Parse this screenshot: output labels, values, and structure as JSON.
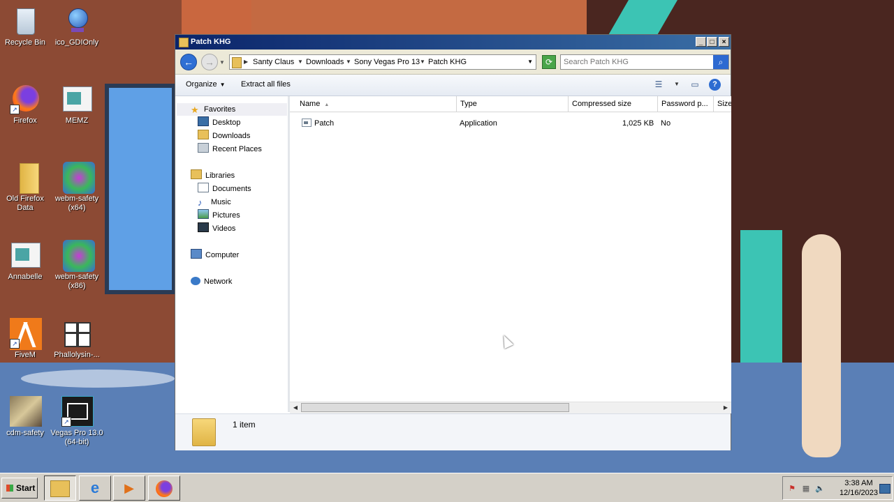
{
  "window": {
    "title": "Patch KHG"
  },
  "address_bar": {
    "crumbs": [
      "Santy Claus",
      "Downloads",
      "Sony Vegas Pro 13",
      "Patch KHG"
    ],
    "search_placeholder": "Search Patch KHG"
  },
  "toolbar": {
    "organize_label": "Organize",
    "extract_label": "Extract all files"
  },
  "nav_pane": {
    "favorites": "Favorites",
    "desktop": "Desktop",
    "downloads": "Downloads",
    "recent_places": "Recent Places",
    "libraries": "Libraries",
    "documents": "Documents",
    "music": "Music",
    "pictures": "Pictures",
    "videos": "Videos",
    "computer": "Computer",
    "network": "Network"
  },
  "file_list": {
    "columns": [
      "Name",
      "Type",
      "Compressed size",
      "Password p...",
      "Size"
    ],
    "rows": [
      {
        "name": "Patch",
        "type": "Application",
        "compressed_size": "1,025 KB",
        "password": "No"
      }
    ]
  },
  "details_pane": {
    "count": "1 item"
  },
  "desktop_icons": [
    {
      "label": "Recycle Bin",
      "icon": "recycle-bin-icon"
    },
    {
      "label": "ico_GDIOnly",
      "icon": "globe-icon"
    },
    {
      "label": "Firefox",
      "icon": "firefox-icon"
    },
    {
      "label": "MEMZ",
      "icon": "window-app-icon"
    },
    {
      "label": "Old Firefox Data",
      "icon": "folder-icon"
    },
    {
      "label": "webm-safety (x64)",
      "icon": "media-player-icon"
    },
    {
      "label": "Annabelle",
      "icon": "window-app-icon"
    },
    {
      "label": "webm-safety (x86)",
      "icon": "media-player-icon"
    },
    {
      "label": "FiveM",
      "icon": "fivem-icon"
    },
    {
      "label": "Phallolysin-...",
      "icon": "gift-icon"
    },
    {
      "label": "cdm-safety",
      "icon": "image-icon"
    },
    {
      "label": "Vegas Pro 13.0 (64-bit)",
      "icon": "vegas-icon"
    }
  ],
  "taskbar": {
    "start_label": "Start",
    "time": "3:38 AM",
    "date": "12/16/2023"
  },
  "colors": {
    "title_blue": "#0a246a",
    "taskbar_gray": "#d4d0c8",
    "accent_blue": "#2e6ad1"
  }
}
